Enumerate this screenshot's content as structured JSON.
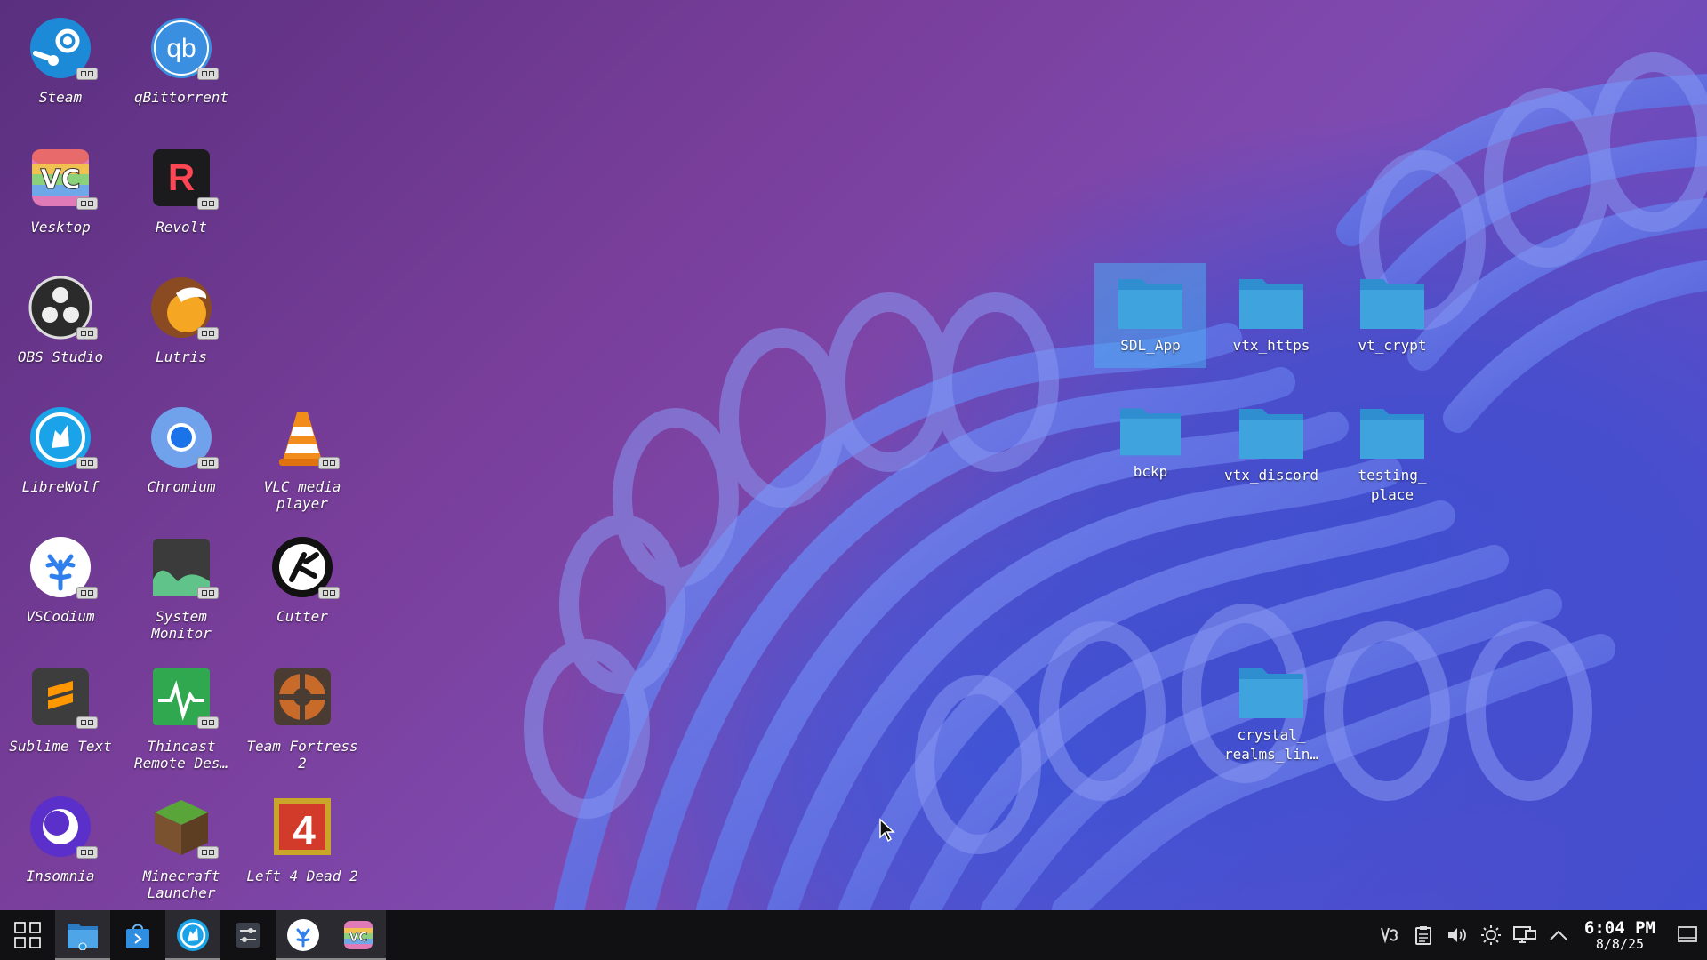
{
  "desktop": {
    "apps": [
      {
        "name": "steam",
        "label": "Steam"
      },
      {
        "name": "qbittorrent",
        "label": "qBittorrent"
      },
      {
        "name": "vesktop",
        "label": "Vesktop"
      },
      {
        "name": "revolt",
        "label": "Revolt"
      },
      {
        "name": "obs-studio",
        "label": "OBS Studio"
      },
      {
        "name": "lutris",
        "label": "Lutris"
      },
      {
        "name": "librewolf",
        "label": "LibreWolf"
      },
      {
        "name": "chromium",
        "label": "Chromium"
      },
      {
        "name": "vlc",
        "label": "VLC media player"
      },
      {
        "name": "vscodium",
        "label": "VSCodium"
      },
      {
        "name": "system-monitor",
        "label": "System Monitor"
      },
      {
        "name": "cutter",
        "label": "Cutter"
      },
      {
        "name": "sublime-text",
        "label": "Sublime Text"
      },
      {
        "name": "thincast",
        "label": "Thincast Remote Des…"
      },
      {
        "name": "team-fortress-2",
        "label": "Team Fortress 2"
      },
      {
        "name": "insomnia",
        "label": "Insomnia"
      },
      {
        "name": "minecraft-launcher",
        "label": "Minecraft Launcher"
      },
      {
        "name": "left-4-dead-2",
        "label": "Left 4 Dead 2"
      }
    ],
    "folders": [
      {
        "label": "SDL_App",
        "selected": true
      },
      {
        "label": "vtx_https"
      },
      {
        "label": "vt_crypt"
      },
      {
        "label": "bckp"
      },
      {
        "label": "vtx_discord"
      },
      {
        "label": "testing_ place"
      },
      {
        "label": "crystal_ realms_lin…"
      }
    ]
  },
  "taskbar": {
    "pinned": [
      "start-menu",
      "file-manager",
      "software-store",
      "librewolf",
      "settings",
      "vscodium",
      "vesktop"
    ],
    "tray": [
      "vesktop-tray-icon",
      "clipboard-icon",
      "volume-icon",
      "brightness-icon",
      "network-icon",
      "chevron-up-icon"
    ],
    "clock": {
      "time": "6:04 PM",
      "date": "8/8/25"
    }
  },
  "colors": {
    "folder": "#3fa3dd",
    "taskbar": "#111114",
    "selection": "#50aaf0"
  }
}
